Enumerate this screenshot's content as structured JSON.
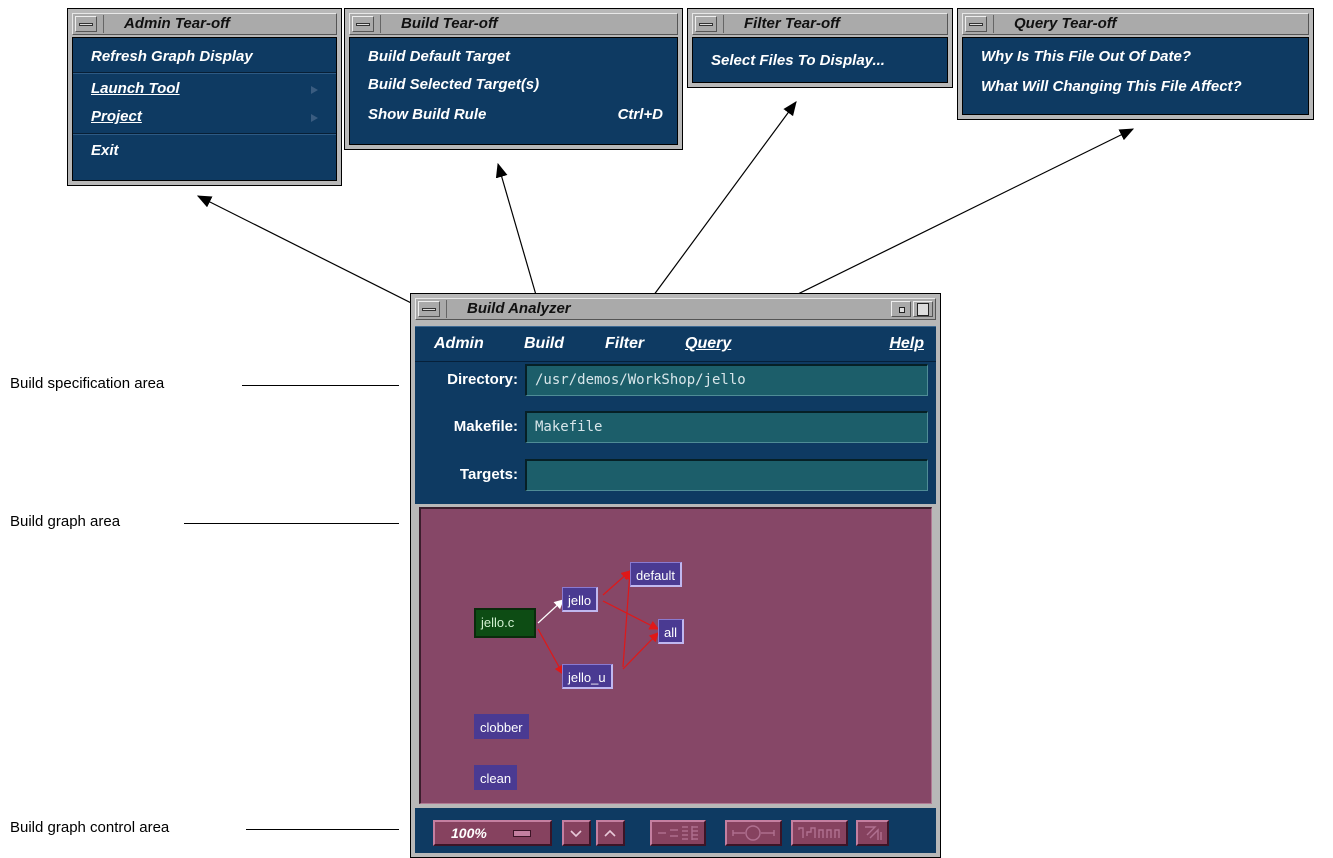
{
  "callouts": {
    "build_spec": "Build specification area",
    "build_graph": "Build graph area",
    "build_graph_control": "Build graph control area"
  },
  "admin_tearoff": {
    "title": "Admin Tear-off",
    "items": {
      "refresh": "Refresh Graph Display",
      "launch_tool": "Launch Tool",
      "project": "Project",
      "exit": "Exit"
    }
  },
  "build_tearoff": {
    "title": "Build Tear-off",
    "items": {
      "build_default": "Build Default Target",
      "build_selected": "Build Selected Target(s)",
      "show_rule": "Show Build Rule",
      "show_rule_accel": "Ctrl+D"
    }
  },
  "filter_tearoff": {
    "title": "Filter Tear-off",
    "items": {
      "select_files": "Select Files To Display..."
    }
  },
  "query_tearoff": {
    "title": "Query Tear-off",
    "items": {
      "why_out_of_date": "Why Is This File Out Of Date?",
      "what_will_change": "What Will Changing This File Affect?"
    }
  },
  "main_window": {
    "title": "Build Analyzer",
    "menubar": {
      "admin": "Admin",
      "build": "Build",
      "filter": "Filter",
      "query": "Query",
      "help": "Help"
    },
    "form": {
      "directory_label": "Directory:",
      "directory_value": "/usr/demos/WorkShop/jello",
      "makefile_label": "Makefile:",
      "makefile_value": "Makefile",
      "targets_label": "Targets:",
      "targets_value": ""
    },
    "graph_nodes": {
      "jello_c": "jello.c",
      "jello": "jello",
      "default": "default",
      "all": "all",
      "jello_u": "jello_u",
      "clobber": "clobber",
      "clean": "clean"
    },
    "controls": {
      "zoom": "100%"
    }
  },
  "colors": {
    "menu_bg": "#0e3a62",
    "graph_bg": "#864767",
    "field_bg": "#1c5e6a",
    "node_bg": "#4a3a92",
    "source_node_bg": "#0d4c14",
    "edge_red": "#e01818"
  }
}
